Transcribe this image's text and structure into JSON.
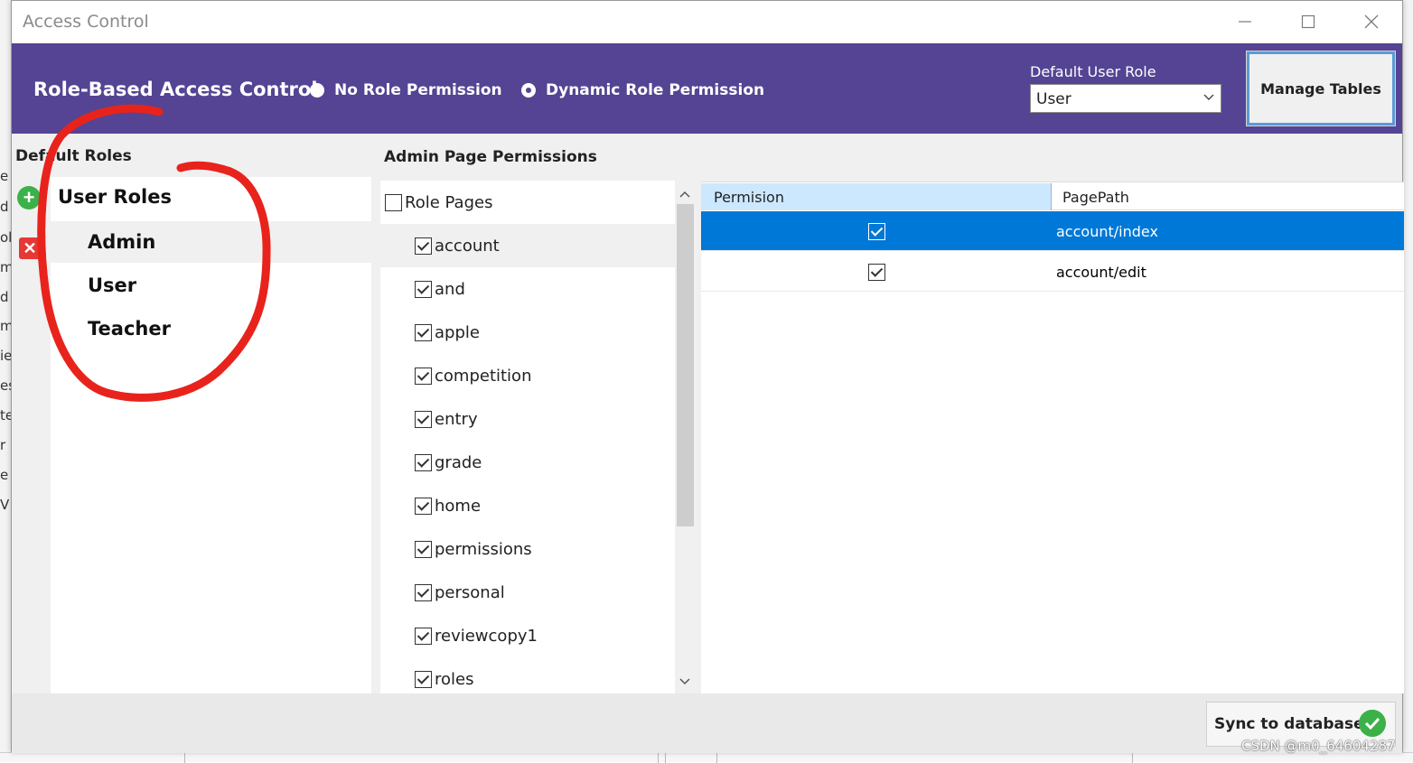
{
  "window": {
    "title": "Access Control"
  },
  "header": {
    "app_title": "Role-Based Access Control",
    "radio_options": [
      {
        "label": "No Role Permission",
        "selected": false
      },
      {
        "label": "Dynamic Role Permission",
        "selected": true
      }
    ],
    "default_role_label": "Default User Role",
    "default_role_value": "User",
    "manage_tables_label": "Manage Tables",
    "accent_color": "#544493"
  },
  "roles": {
    "heading": "Default Roles",
    "group_label": "User Roles",
    "items": [
      "Admin",
      "User",
      "Teacher"
    ],
    "selected": "Admin"
  },
  "pages": {
    "heading": "Admin Page Permissions",
    "root_label": "Role Pages",
    "root_checked": false,
    "items": [
      {
        "label": "account",
        "checked": true
      },
      {
        "label": "and",
        "checked": true
      },
      {
        "label": "apple",
        "checked": true
      },
      {
        "label": "competition",
        "checked": true
      },
      {
        "label": "entry",
        "checked": true
      },
      {
        "label": "grade",
        "checked": true
      },
      {
        "label": "home",
        "checked": true
      },
      {
        "label": "permissions",
        "checked": true
      },
      {
        "label": "personal",
        "checked": true
      },
      {
        "label": "reviewcopy1",
        "checked": true
      },
      {
        "label": "roles",
        "checked": true
      }
    ]
  },
  "grid": {
    "columns": [
      "Permision",
      "PagePath"
    ],
    "rows": [
      {
        "permission": true,
        "path": "account/index",
        "selected": true
      },
      {
        "permission": true,
        "path": "account/edit",
        "selected": false
      }
    ]
  },
  "footer": {
    "sync_label": "Sync to database"
  },
  "watermark": "CSDN @m0_64604287",
  "background_fragments": [
    "e",
    "d",
    "ol",
    "m",
    "d",
    "m",
    "ie",
    "es",
    "te",
    "r",
    "e",
    "V"
  ]
}
